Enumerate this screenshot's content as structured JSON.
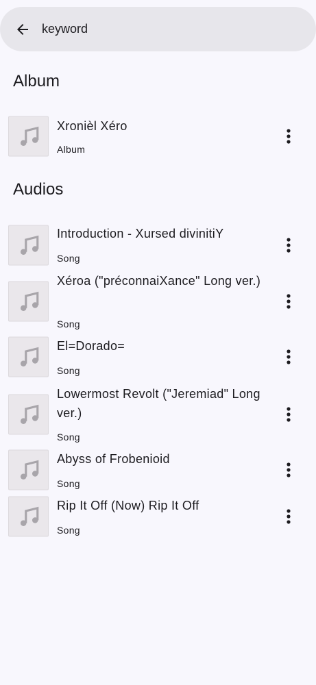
{
  "search": {
    "value": "keyword",
    "placeholder": ""
  },
  "sections": {
    "album_title": "Album",
    "audios_title": "Audios"
  },
  "albums": [
    {
      "title": "Xronièl Xéro",
      "type": "Album"
    }
  ],
  "songs": [
    {
      "title": "Introduction - Xursed divinitiY",
      "type": "Song"
    },
    {
      "title": "Xéroa (\"préconnaiXance\" Long ver.)",
      "type": "Song"
    },
    {
      "title": "El=Dorado=",
      "type": "Song"
    },
    {
      "title": "Lowermost Revolt (\"Jeremiad\" Long ver.)",
      "type": "Song"
    },
    {
      "title": "Abyss of Frobenioid",
      "type": "Song"
    },
    {
      "title": "Rip It Off (Now) Rip It Off",
      "type": "Song"
    }
  ],
  "icons": {
    "back": "arrow-back-icon",
    "thumbnail": "music-note-icon",
    "menu": "more-vert-icon"
  },
  "colors": {
    "background": "#f8f7fd",
    "search_bar": "#e7e6eb",
    "thumbnail_bg": "#eae7eb",
    "note_icon": "#a8a5aa",
    "text": "#1c1b1f"
  }
}
